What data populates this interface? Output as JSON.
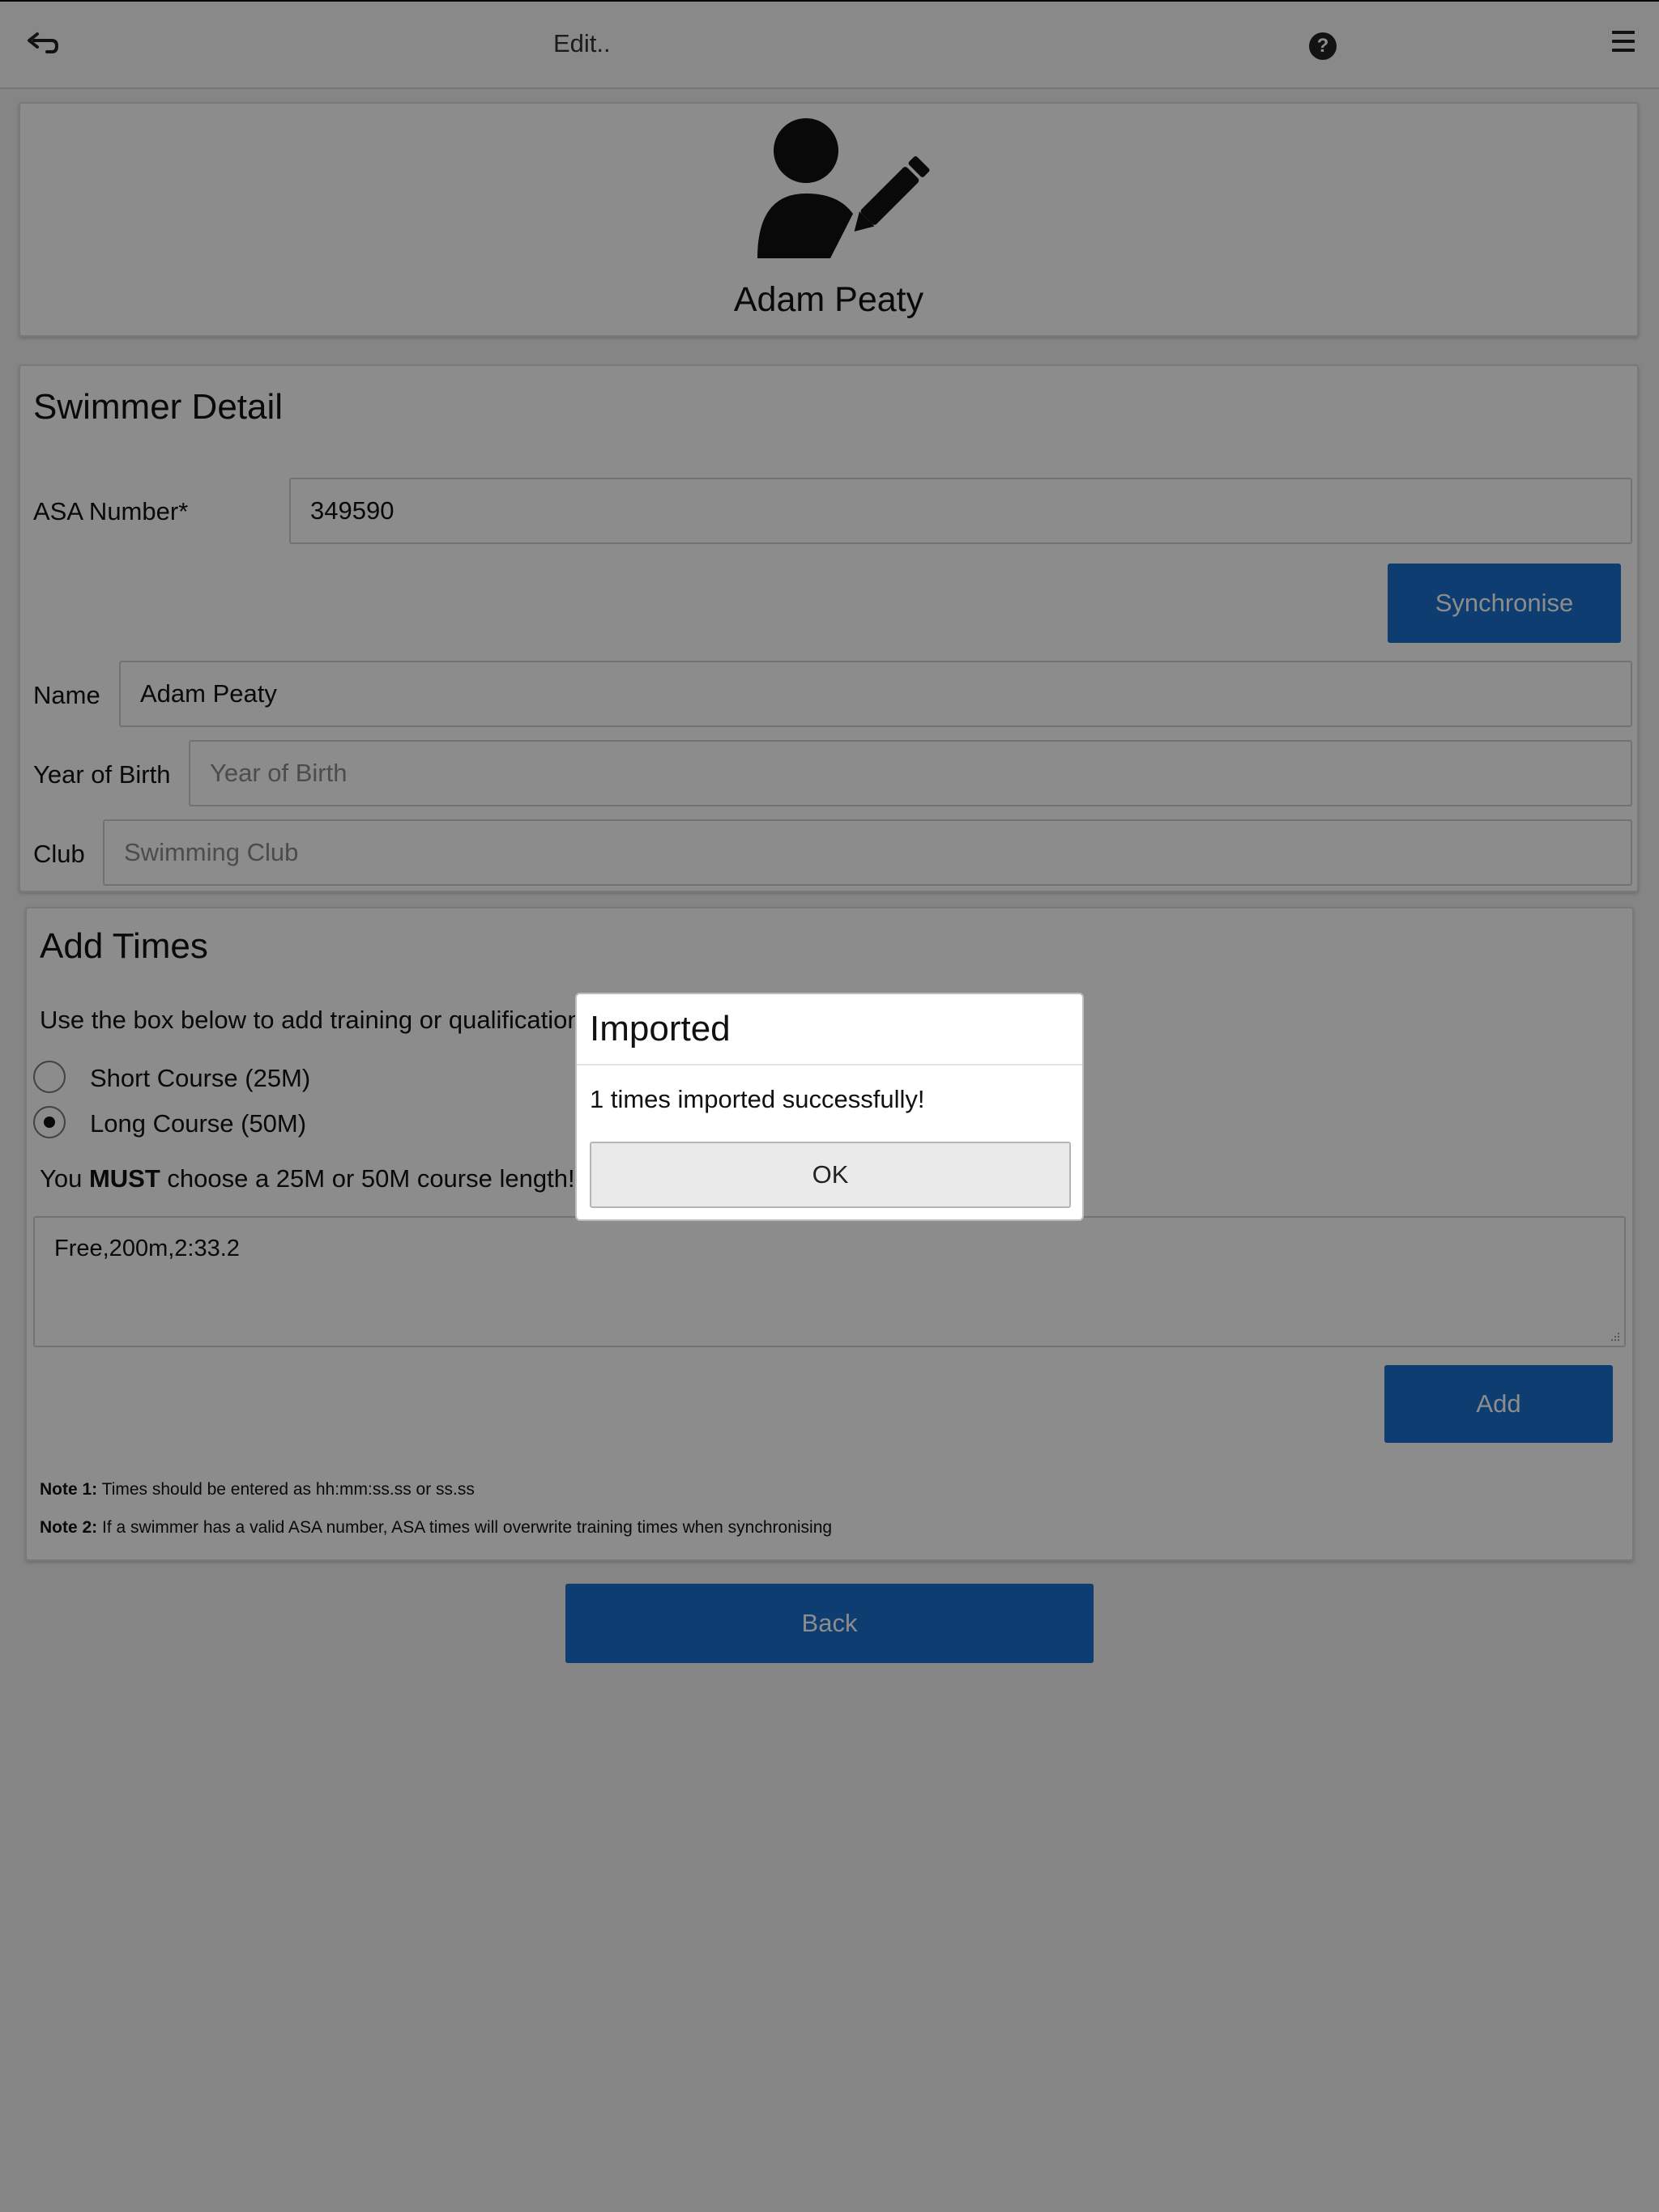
{
  "header": {
    "title": "Edit..",
    "help_glyph": "?",
    "icons": [
      "back-arrow-icon",
      "help-icon",
      "menu-icon"
    ]
  },
  "profile": {
    "name": "Adam Peaty",
    "icon": "user-edit-icon"
  },
  "swimmer_detail": {
    "heading": "Swimmer Detail",
    "asa_label": "ASA Number*",
    "asa_value": "349590",
    "sync_button": "Synchronise",
    "name_label": "Name",
    "name_value": "Adam Peaty",
    "yob_label": "Year of Birth",
    "yob_placeholder": "Year of Birth",
    "club_label": "Club",
    "club_placeholder": "Swimming Club"
  },
  "add_times": {
    "heading": "Add Times",
    "instruction": "Use the box below to add training or qualification times. Add one time per row!",
    "radio_short": "Short Course (25M)",
    "radio_long": "Long Course (50M)",
    "selected_course": "Long Course (50M)",
    "must_prefix": "You ",
    "must_bold": "MUST",
    "must_suffix": " choose a 25M or 50M course length!",
    "textarea_value": "Free,200m,2:33.2",
    "add_button": "Add",
    "note1_label": "Note 1:",
    "note1_text": " Times should be entered as hh:mm:ss.ss or ss.ss",
    "note2_label": "Note 2:",
    "note2_text": " If a swimmer has a valid ASA number, ASA times will overwrite training times when synchronising"
  },
  "back_button": "Back",
  "dialog": {
    "title": "Imported",
    "message": "1 times imported successfully!",
    "ok": "OK"
  },
  "colors": {
    "primary": "#1a6fd0",
    "overlay": "rgba(0,0,0,0.45)"
  }
}
